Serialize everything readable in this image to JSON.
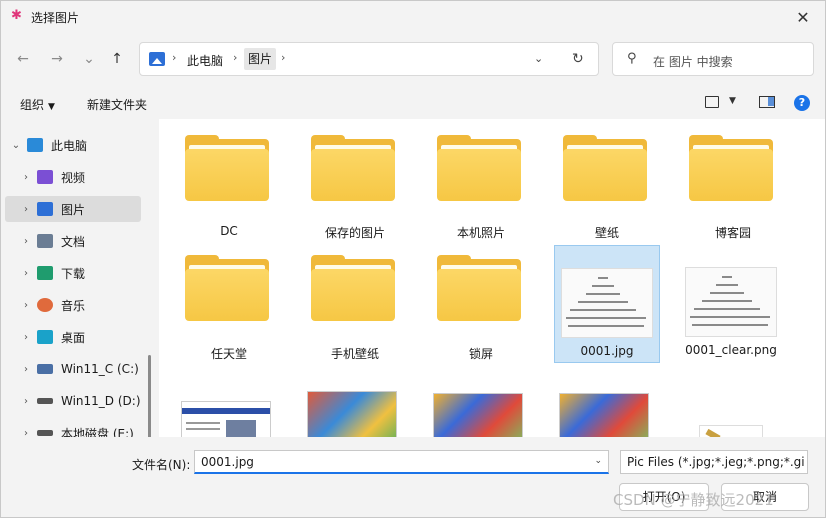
{
  "window": {
    "title": "选择图片",
    "close_glyph": "✕"
  },
  "nav_buttons": {
    "back": "←",
    "forward": "→",
    "recent": "⌄",
    "up": "↑"
  },
  "address": {
    "segments": [
      "此电脑",
      "图片"
    ],
    "sep": "›",
    "dropdown": "⌄",
    "refresh": "↻"
  },
  "search": {
    "placeholder": "在 图片 中搜索",
    "icon_glyph": "⚲"
  },
  "toolbar": {
    "organize": "组织",
    "new_folder": "新建文件夹",
    "caret": "▼",
    "help": "?"
  },
  "sidebar": {
    "items": [
      {
        "label": "此电脑",
        "chevron": "⌄",
        "icon_color": "#2a8ad8"
      },
      {
        "label": "视频",
        "chevron": "›",
        "icon_color": "#7b4fd4"
      },
      {
        "label": "图片",
        "chevron": "›",
        "icon_color": "#2d6fd6"
      },
      {
        "label": "文档",
        "chevron": "›",
        "icon_color": "#6b7d94"
      },
      {
        "label": "下载",
        "chevron": "›",
        "icon_color": "#1f9c6e"
      },
      {
        "label": "音乐",
        "chevron": "›",
        "icon_color": "#e06a3c"
      },
      {
        "label": "桌面",
        "chevron": "›",
        "icon_color": "#1aa2c9"
      },
      {
        "label": "Win11_C (C:)",
        "chevron": "›",
        "icon_color": "#4a6fa5"
      },
      {
        "label": "Win11_D (D:)",
        "chevron": "›",
        "icon_color": "#555555"
      },
      {
        "label": "本地磁盘 (E:)",
        "chevron": "›",
        "icon_color": "#555555"
      }
    ]
  },
  "files": {
    "row1": [
      "DC",
      "保存的图片",
      "本机照片",
      "壁纸",
      "博客园"
    ],
    "row2": [
      "任天堂",
      "手机壁纸",
      "锁屏",
      "0001.jpg",
      "0001_clear.png"
    ]
  },
  "bottom": {
    "filename_label": "文件名(N):",
    "filename_value": "0001.jpg",
    "filetype": "Pic Files (*.jpg;*.jeg;*.png;*.gi",
    "open": "打开(O)",
    "cancel": "取消",
    "dropdown": "⌄",
    "watermark": "CSDN @宁静致远2021"
  },
  "colors": {
    "accent": "#1a73e8",
    "folder": "#f6c744",
    "selection": "#cce4f7"
  }
}
